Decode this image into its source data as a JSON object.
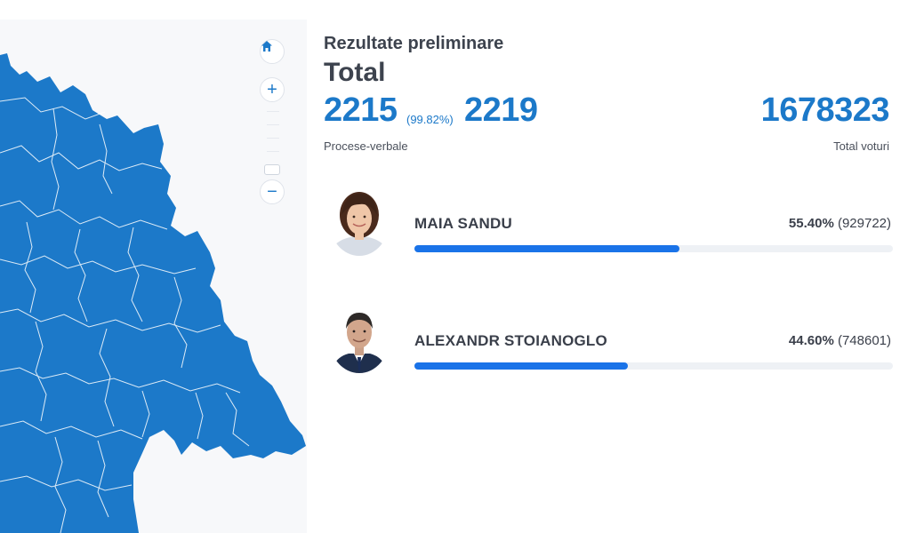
{
  "map": {
    "fill_color": "#1c79c9",
    "controls": {
      "home_icon": "home-icon",
      "zoom_in_label": "+",
      "zoom_out_label": "−"
    }
  },
  "results": {
    "subtitle": "Rezultate preliminare",
    "title": "Total",
    "processed_reports": "2215",
    "processed_percent": "(99.82%)",
    "total_reports": "2219",
    "total_votes": "1678323",
    "processed_label": "Procese-verbale",
    "total_votes_label": "Total voturi",
    "accent_color": "#1c79c9",
    "bar_color": "#1a73e8"
  },
  "candidates": [
    {
      "name": "MAIA SANDU",
      "percent_text": "55.40%",
      "votes_text": "(929722)",
      "share": 0.554
    },
    {
      "name": "ALEXANDR STOIANOGLO",
      "percent_text": "44.60%",
      "votes_text": "(748601)",
      "share": 0.446
    }
  ]
}
